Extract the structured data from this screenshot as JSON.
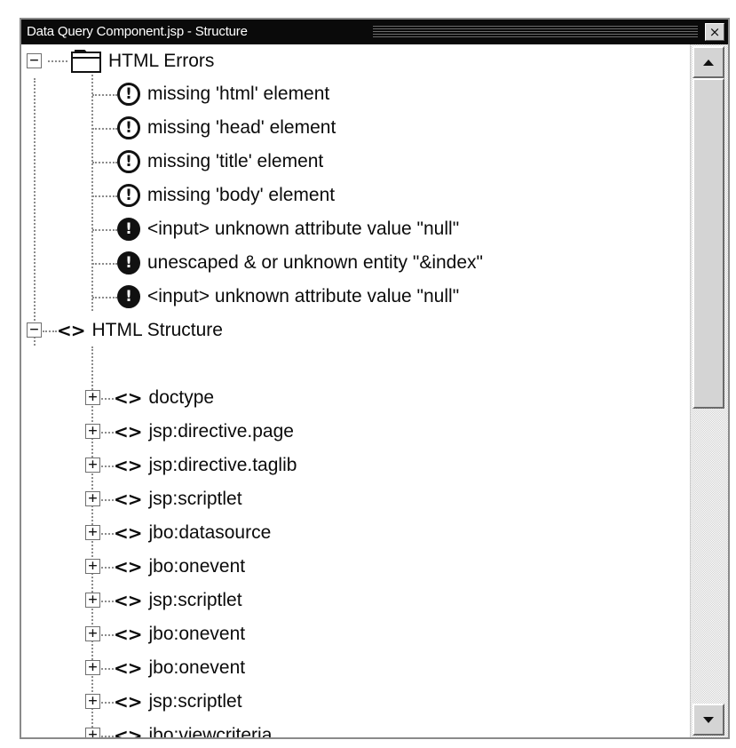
{
  "window": {
    "title": "Data Query Component.jsp - Structure",
    "close_glyph": "×"
  },
  "tree": {
    "errors_group": {
      "label": "HTML Errors",
      "toggle": "−",
      "icon": "folder-icon",
      "items": [
        {
          "label": "missing 'html' element",
          "severity": "warning"
        },
        {
          "label": "missing 'head' element",
          "severity": "warning"
        },
        {
          "label": "missing 'title' element",
          "severity": "warning"
        },
        {
          "label": "missing 'body' element",
          "severity": "warning"
        },
        {
          "label": "<input> unknown attribute value \"null\"",
          "severity": "error"
        },
        {
          "label": "unescaped & or unknown entity \"&index\"",
          "severity": "error"
        },
        {
          "label": "<input> unknown attribute value \"null\"",
          "severity": "error"
        }
      ]
    },
    "structure_group": {
      "label": "HTML Structure",
      "toggle": "−",
      "icon": "tag-icon",
      "items": [
        {
          "label": "doctype",
          "toggle": "+"
        },
        {
          "label": "jsp:directive.page",
          "toggle": "+"
        },
        {
          "label": "jsp:directive.taglib",
          "toggle": "+"
        },
        {
          "label": "jsp:scriptlet",
          "toggle": "+"
        },
        {
          "label": "jbo:datasource",
          "toggle": "+"
        },
        {
          "label": "jbo:onevent",
          "toggle": "+"
        },
        {
          "label": "jsp:scriptlet",
          "toggle": "+"
        },
        {
          "label": "jbo:onevent",
          "toggle": "+"
        },
        {
          "label": "jbo:onevent",
          "toggle": "+"
        },
        {
          "label": "jsp:scriptlet",
          "toggle": "+"
        },
        {
          "label": "jbo:viewcriteria",
          "toggle": "+"
        }
      ]
    }
  },
  "icons": {
    "warning_glyph": "!",
    "error_glyph": "!",
    "tag_glyph": "<>"
  },
  "colors": {
    "titlebar": "#0a0a0a",
    "text": "#0b0b0b",
    "scroll_face": "#d4d4d4"
  }
}
